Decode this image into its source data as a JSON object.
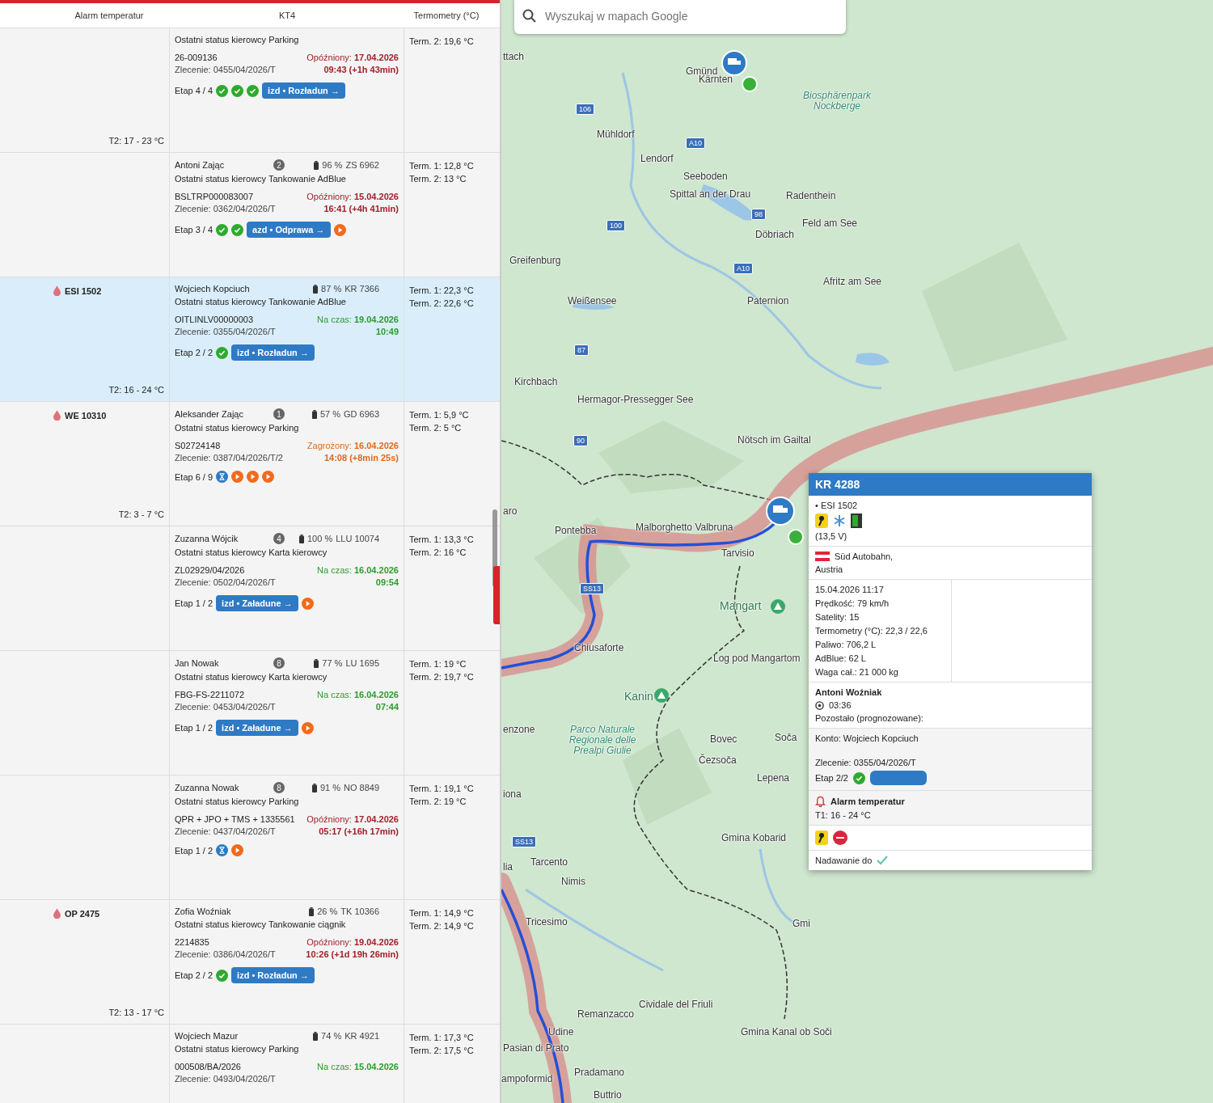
{
  "panel": {
    "columns": [
      "Alarm temperatur",
      "KT4",
      "Termometry (°C)"
    ],
    "rows": [
      {
        "selected": false,
        "status": "Ostatni status kierowcy Parking",
        "order": "26-009136",
        "zlecenie": "Zlecenie: 0455/04/2026/T",
        "timing": {
          "kind": "late",
          "label": "Opóźniony:",
          "date": "17.04.2026",
          "time": "09:43 (+1h 43min)"
        },
        "stage": "Etap 4 / 4",
        "steps": [
          {
            "kind": "done"
          },
          {
            "kind": "done"
          },
          {
            "kind": "done"
          },
          {
            "kind": "button",
            "label": "izd • Rozładun →"
          }
        ],
        "terms": [
          "Term. 2: 19,6 °C"
        ],
        "alarm": {
          "range": "T2: 17 - 23 °C"
        }
      },
      {
        "selected": false,
        "name": "Antoni Zając",
        "badge": "2",
        "battery": "96 %",
        "plate": "ZS 6962",
        "status": "Ostatni status kierowcy Tankowanie AdBlue",
        "order": "BSLTRP000083007",
        "zlecenie": "Zlecenie: 0362/04/2026/T",
        "timing": {
          "kind": "late",
          "label": "Opóźniony:",
          "date": "15.04.2026",
          "time": "16:41 (+4h 41min)"
        },
        "stage": "Etap 3 / 4",
        "steps": [
          {
            "kind": "done"
          },
          {
            "kind": "done"
          },
          {
            "kind": "button",
            "label": "azd • Odprawa →"
          },
          {
            "kind": "play"
          }
        ],
        "terms": [
          "Term. 1: 12,8 °C",
          "Term. 2: 13 °C"
        ]
      },
      {
        "selected": true,
        "name": "Wojciech Kopciuch",
        "battery": "87 %",
        "plate": "KR 7366",
        "status": "Ostatni status kierowcy Tankowanie AdBlue",
        "order": "OITLINLV00000003",
        "zlecenie": "Zlecenie: 0355/04/2026/T",
        "timing": {
          "kind": "on_time",
          "label": "Na czas:",
          "date": "19.04.2026",
          "time": "10:49"
        },
        "stage": "Etap 2 / 2",
        "steps": [
          {
            "kind": "done"
          },
          {
            "kind": "button",
            "label": "izd • Rozładun →"
          }
        ],
        "terms": [
          "Term. 1: 22,3 °C",
          "Term. 2: 22,6 °C"
        ],
        "alarm": {
          "vehicle": "ESI 1502",
          "range": "T2: 16 - 24 °C"
        }
      },
      {
        "selected": false,
        "name": "Aleksander Zając",
        "badge": "1",
        "battery": "57 %",
        "plate": "GD 6963",
        "status": "Ostatni status kierowcy Parking",
        "order": "S02724148",
        "zlecenie": "Zlecenie: 0387/04/2026/T/2",
        "timing": {
          "kind": "risk",
          "label": "Zagrożony:",
          "date": "16.04.2026",
          "time": "14:08 (+8min 25s)"
        },
        "stage": "Etap 6 / 9",
        "steps": [
          {
            "kind": "wait"
          },
          {
            "kind": "play"
          },
          {
            "kind": "play"
          },
          {
            "kind": "play"
          }
        ],
        "terms": [
          "Term. 1: 5,9 °C",
          "Term. 2: 5 °C"
        ],
        "alarm": {
          "vehicle": "WE 10310",
          "range": "T2: 3 - 7 °C"
        }
      },
      {
        "selected": false,
        "name": "Zuzanna Wójcik",
        "badge": "4",
        "battery": "100 %",
        "plate": "LLU 10074",
        "status": "Ostatni status kierowcy Karta kierowcy",
        "order": "ZL02929/04/2026",
        "zlecenie": "Zlecenie: 0502/04/2026/T",
        "timing": {
          "kind": "on_time",
          "label": "Na czas:",
          "date": "16.04.2026",
          "time": "09:54"
        },
        "stage": "Etap 1 / 2",
        "steps": [
          {
            "kind": "button",
            "label": "izd • Załadune →"
          },
          {
            "kind": "play"
          }
        ],
        "terms": [
          "Term. 1: 13,3 °C",
          "Term. 2: 16 °C"
        ]
      },
      {
        "selected": false,
        "name": "Jan Nowak",
        "badge": "8",
        "battery": "77 %",
        "plate": "LU 1695",
        "status": "Ostatni status kierowcy Karta kierowcy",
        "order": "FBG-FS-2211072",
        "zlecenie": "Zlecenie: 0453/04/2026/T",
        "timing": {
          "kind": "on_time",
          "label": "Na czas:",
          "date": "16.04.2026",
          "time": "07:44"
        },
        "stage": "Etap 1 / 2",
        "steps": [
          {
            "kind": "button",
            "label": "izd • Załadune →"
          },
          {
            "kind": "play"
          }
        ],
        "terms": [
          "Term. 1: 19 °C",
          "Term. 2: 19,7 °C"
        ]
      },
      {
        "selected": false,
        "name": "Zuzanna Nowak",
        "badge": "8",
        "battery": "91 %",
        "plate": "NO 8849",
        "status": "Ostatni status kierowcy Parking",
        "order": "QPR + JPO + TMS + 1335561",
        "zlecenie": "Zlecenie: 0437/04/2026/T",
        "timing": {
          "kind": "late",
          "label": "Opóźniony:",
          "date": "17.04.2026",
          "time": "05:17 (+16h 17min)"
        },
        "stage": "Etap 1 / 2",
        "steps": [
          {
            "kind": "wait"
          },
          {
            "kind": "play"
          }
        ],
        "terms": [
          "Term. 1: 19,1 °C",
          "Term. 2: 19 °C"
        ]
      },
      {
        "selected": false,
        "name": "Zofia Woźniak",
        "battery": "26 %",
        "plate": "TK 10366",
        "status": "Ostatni status kierowcy Tankowanie ciągnik",
        "order": "2214835",
        "zlecenie": "Zlecenie: 0386/04/2026/T",
        "timing": {
          "kind": "late",
          "label": "Opóźniony:",
          "date": "19.04.2026",
          "time": "10:26 (+1d 19h 26min)"
        },
        "stage": "Etap 2 / 2",
        "steps": [
          {
            "kind": "done"
          },
          {
            "kind": "button",
            "label": "izd • Rozładun →"
          }
        ],
        "terms": [
          "Term. 1: 14,9 °C",
          "Term. 2: 14,9 °C"
        ],
        "alarm": {
          "vehicle": "OP 2475",
          "range": "T2: 13 - 17 °C"
        }
      },
      {
        "selected": false,
        "name": "Wojciech Mazur",
        "battery": "74 %",
        "plate": "KR 4921",
        "status": "Ostatni status kierowcy Parking",
        "order": "000508/BA/2026",
        "zlecenie": "Zlecenie: 0493/04/2026/T",
        "timing": {
          "kind": "on_time",
          "label": "Na czas:",
          "date": "15.04.2026"
        },
        "terms": [
          "Term. 1: 17,3 °C",
          "Term. 2: 17,5 °C"
        ]
      }
    ]
  },
  "map": {
    "search": {
      "placeholder": "Wyszukaj w mapach Google"
    },
    "labels": [
      {
        "text": "ttach",
        "kind": "town"
      },
      {
        "text": "Gmünd",
        "kind": "town"
      },
      {
        "text": "Kärnten",
        "kind": "town"
      },
      {
        "text": "Biosphärenpark Nockberge",
        "kind": "park"
      },
      {
        "text": "Mühldorf",
        "kind": "town"
      },
      {
        "text": "Lendorf",
        "kind": "town"
      },
      {
        "text": "Seeboden",
        "kind": "town"
      },
      {
        "text": "Spittal an der Drau",
        "kind": "town"
      },
      {
        "text": "Radenthein",
        "kind": "town"
      },
      {
        "text": "Feld am See",
        "kind": "town"
      },
      {
        "text": "Döbriach",
        "kind": "town"
      },
      {
        "text": "Greifenburg",
        "kind": "town"
      },
      {
        "text": "Weißensee",
        "kind": "town"
      },
      {
        "text": "Paternion",
        "kind": "town"
      },
      {
        "text": "Afritz am See",
        "kind": "town"
      },
      {
        "text": "Kirchbach",
        "kind": "town"
      },
      {
        "text": "Hermagor-Pressegger See",
        "kind": "town"
      },
      {
        "text": "Nötsch im Gailtal",
        "kind": "town"
      },
      {
        "text": "aro",
        "kind": "town"
      },
      {
        "text": "Pontebba",
        "kind": "town"
      },
      {
        "text": "Malborghetto Valbruna",
        "kind": "town"
      },
      {
        "text": "Tarvisio",
        "kind": "town"
      },
      {
        "text": "Mangart",
        "kind": "peak"
      },
      {
        "text": "Chiusaforte",
        "kind": "town"
      },
      {
        "text": "Log pod Mangartom",
        "kind": "town"
      },
      {
        "text": "Kanin",
        "kind": "peak"
      },
      {
        "text": "enzone",
        "kind": "town"
      },
      {
        "text": "Parco Naturale Regionale delle Prealpi Giulie",
        "kind": "park"
      },
      {
        "text": "Bovec",
        "kind": "town"
      },
      {
        "text": "Soča",
        "kind": "town"
      },
      {
        "text": "Čezsoča",
        "kind": "town"
      },
      {
        "text": "Lepena",
        "kind": "town"
      },
      {
        "text": "iona",
        "kind": "town"
      },
      {
        "text": "Gmina Kobarid",
        "kind": "town"
      },
      {
        "text": "Tarcento",
        "kind": "town"
      },
      {
        "text": "lia",
        "kind": "town"
      },
      {
        "text": "Nimis",
        "kind": "town"
      },
      {
        "text": "Tricesimo",
        "kind": "town"
      },
      {
        "text": "Gmi",
        "kind": "town"
      },
      {
        "text": "Cividale del Friuli",
        "kind": "town"
      },
      {
        "text": "Remanzacco",
        "kind": "town"
      },
      {
        "text": "Udine",
        "kind": "town"
      },
      {
        "text": "Pasian di Prato",
        "kind": "town"
      },
      {
        "text": "Gmina Kanal ob Soči",
        "kind": "town"
      },
      {
        "text": "Pradamano",
        "kind": "town"
      },
      {
        "text": "ampoformid",
        "kind": "town"
      },
      {
        "text": "Buttrio",
        "kind": "town"
      }
    ],
    "roads": [
      "106",
      "A10",
      "100",
      "98",
      "A10",
      "87",
      "90",
      "SS13",
      "SS13"
    ],
    "popup": {
      "title": "KR 4288",
      "trailer": "• ESI 1502",
      "voltage": "(13,5 V)",
      "address": "Süd Autobahn,",
      "country": "Austria",
      "details": [
        "15.04.2026 11:17",
        "Prędkość: 79 km/h",
        "Satelity: 15",
        "Termometry (°C): 22,3 / 22,6",
        "Paliwo: 706,2 L",
        "AdBlue: 62 L",
        "Waga cał.: 21 000 kg"
      ],
      "driver": "Antoni Woźniak",
      "drive_time": "03:36",
      "remaining": "Pozostało (prognozowane):",
      "account": "Konto: Wojciech Kopciuch",
      "order": "Zlecenie: 0355/04/2026/T",
      "stage": "Etap 2/2",
      "alarm": "Alarm temperatur",
      "alarm_range": "T1: 16 - 24 °C",
      "broadcast": "Nadawanie do"
    }
  }
}
